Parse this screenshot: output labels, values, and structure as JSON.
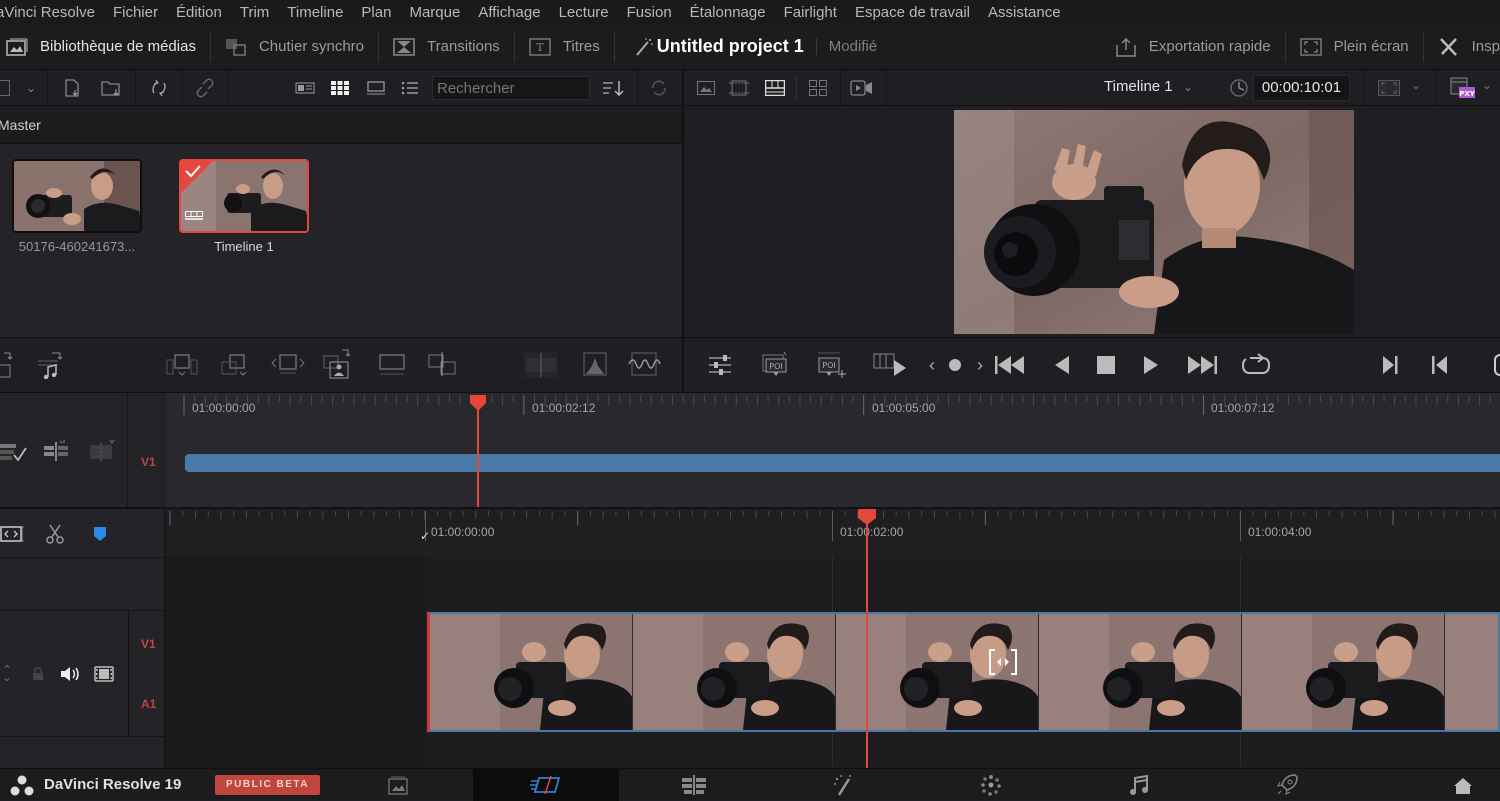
{
  "menubar": {
    "items": [
      "aVinci Resolve",
      "Fichier",
      "Édition",
      "Trim",
      "Timeline",
      "Plan",
      "Marque",
      "Affichage",
      "Lecture",
      "Fusion",
      "Étalonnage",
      "Fairlight",
      "Espace de travail",
      "Assistance"
    ]
  },
  "toolbar": {
    "media_library": "Bibliothèque de médias",
    "sync_bin": "Chutier synchro",
    "transitions": "Transitions",
    "titles": "Titres",
    "project_title": "Untitled project 1",
    "project_status": "Modifié",
    "quick_export": "Exportation rapide",
    "fullscreen": "Plein écran",
    "inspector": "Insp"
  },
  "media_pool": {
    "search_placeholder": "Rechercher",
    "bin_name": "Master",
    "clips": [
      {
        "name": "50176-460241673...",
        "selected": false,
        "type": "video"
      },
      {
        "name": "Timeline 1",
        "selected": true,
        "type": "timeline"
      }
    ]
  },
  "viewer": {
    "timeline_name": "Timeline 1",
    "timecode": "00:00:10:01",
    "proxy_badge": "PXY"
  },
  "upper_timeline": {
    "track": "V1",
    "ruler_labels": [
      "01:00:00:00",
      "01:00:02:12",
      "01:00:05:00",
      "01:00:07:12"
    ],
    "playhead_position_tc": "01:00:01:23"
  },
  "lower_timeline": {
    "tracks": [
      "V1",
      "A1"
    ],
    "ruler_labels": [
      "01:00:00:00",
      "01:00:02:00",
      "01:00:04:00"
    ],
    "playhead_position_tc": "01:00:02:01"
  },
  "footer": {
    "app_name": "DaVinci Resolve 19",
    "beta_badge": "PUBLIC BETA",
    "pages": [
      "media",
      "cut",
      "edit",
      "fusion",
      "color",
      "fairlight",
      "deliver"
    ],
    "active_page": "cut"
  },
  "colors": {
    "accent_red": "#e5473e",
    "clip_blue": "#4a7aa8",
    "beta_badge": "#c0453d",
    "track_label_red": "#c0453d"
  }
}
